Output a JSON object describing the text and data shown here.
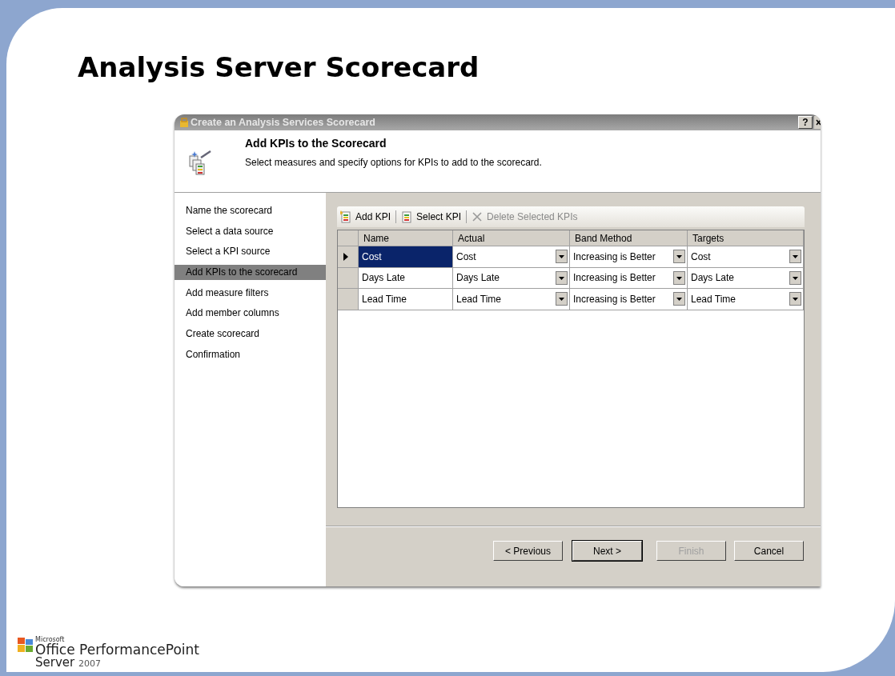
{
  "slide": {
    "title": "Analysis Server Scorecard"
  },
  "window": {
    "title": "Create an Analysis Services Scorecard",
    "help": "?"
  },
  "header": {
    "title": "Add KPIs to the Scorecard",
    "description": "Select measures and specify options for KPIs to add to the scorecard."
  },
  "steps": [
    {
      "label": "Name the scorecard",
      "selected": false
    },
    {
      "label": "Select a data source",
      "selected": false
    },
    {
      "label": "Select a KPI source",
      "selected": false
    },
    {
      "label": "Add KPIs to the scorecard",
      "selected": true
    },
    {
      "label": "Add measure filters",
      "selected": false
    },
    {
      "label": "Add member columns",
      "selected": false
    },
    {
      "label": "Create scorecard",
      "selected": false
    },
    {
      "label": "Confirmation",
      "selected": false
    }
  ],
  "toolbar": [
    {
      "kind": "add",
      "label": "Add KPI",
      "disabled": false
    },
    {
      "kind": "select",
      "label": "Select KPI",
      "disabled": false
    },
    {
      "kind": "delete",
      "label": "Delete Selected KPIs",
      "disabled": true
    }
  ],
  "table": {
    "columns": [
      "Name",
      "Actual",
      "Band Method",
      "Targets"
    ],
    "rows": [
      {
        "selected": true,
        "cells": [
          "Cost",
          "Cost",
          "Increasing is Better",
          "Cost"
        ]
      },
      {
        "selected": false,
        "cells": [
          "Days Late",
          "Days Late",
          "Increasing is Better",
          "Days Late"
        ]
      },
      {
        "selected": false,
        "cells": [
          "Lead Time",
          "Lead Time",
          "Increasing is Better",
          "Lead Time"
        ]
      }
    ]
  },
  "buttons": [
    {
      "label": "< Previous",
      "disabled": false,
      "default": false
    },
    {
      "label": "Next >",
      "disabled": false,
      "default": true
    },
    {
      "label": "Finish",
      "disabled": true,
      "default": false
    },
    {
      "label": "Cancel",
      "disabled": false,
      "default": false
    }
  ],
  "logo": {
    "brand": "Microsoft",
    "product": "Office PerformancePoint",
    "server": "Server",
    "year": "2007"
  }
}
